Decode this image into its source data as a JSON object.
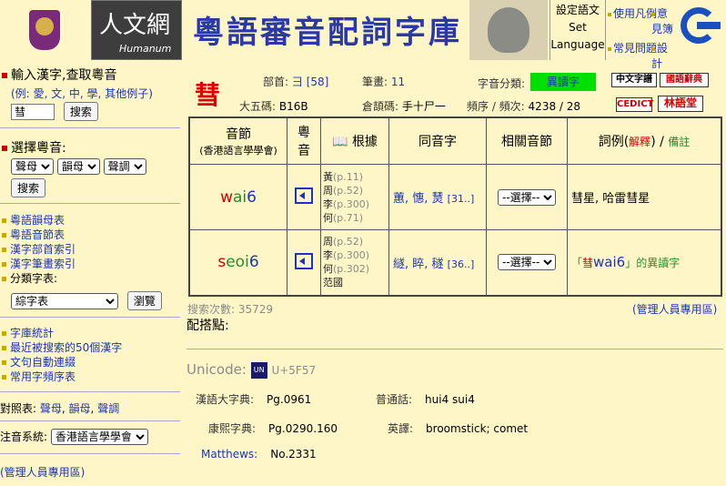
{
  "header": {
    "logo_humanum_big": "人文網",
    "logo_humanum_word": "Humanum",
    "title": "粵語審音配詞字庫",
    "set_language": [
      "設定語文",
      "Set",
      "Language"
    ],
    "nav": {
      "usage": "使用凡例",
      "feedback": "意見簿",
      "faq": "常見問題",
      "stats": "設計"
    }
  },
  "sidebar": {
    "input_title": "輸入漢字,查取粵音",
    "examples_prefix": "(例:",
    "examples": [
      "愛",
      "文",
      "中",
      "學"
    ],
    "examples_more": "其他例子",
    "examples_suffix": ")",
    "search_value": "彗",
    "search_button": "搜索",
    "choose_title": "選擇粵音:",
    "initial_select": "聲母",
    "final_select": "韻母",
    "tone_select": "聲調",
    "search_button2": "搜索",
    "links1": [
      "粵語韻母表",
      "粵語音節表",
      "漢字部首索引",
      "漢字筆畫索引"
    ],
    "category_label": "分類字表:",
    "category_select": "綜字表",
    "browse_button": "瀏覽",
    "links2": [
      "字庫統計",
      "最近被搜索的50個漢字",
      "文句自動連綴",
      "常用字頻序表"
    ],
    "compare_label": "對照表:",
    "compare_links": [
      "聲母",
      "韻母",
      "聲調"
    ],
    "romanization_label": "注音系統:",
    "romanization_value": "香港語言學學會",
    "admin_link": "(管理人員專用區)"
  },
  "character": {
    "glyph": "彗",
    "radical_label": "部首:",
    "radical": "彐",
    "radical_num": "[58]",
    "strokes_label": "筆畫:",
    "strokes": "11",
    "category_label": "字音分類:",
    "category": "異讀字",
    "big5_label": "大五碼:",
    "big5": "B16B",
    "cangjie_label": "倉頡碼:",
    "cangjie": "手十尸一",
    "freq_label": "頻序 / 頻次:",
    "freq": "4238 / 28",
    "dict_buttons": [
      "中文字譜",
      "國語辭典",
      "CEDICT",
      "林語堂"
    ]
  },
  "table": {
    "headers": {
      "syllable": "音節",
      "syllable_sub": "(香港語言學學會)",
      "audio": "粵音",
      "basis": "根據",
      "homophones": "同音字",
      "related": "相關音節",
      "examples": "詞例(",
      "examples_link": "解釋",
      "examples_close": ")",
      "examples_sep": "/",
      "notes": "備註"
    },
    "rows": [
      {
        "initial": "w",
        "final": "ai",
        "tone": "6",
        "sources": [
          {
            "name": "黃",
            "page": "(p.11)"
          },
          {
            "name": "周",
            "page": "(p.52)"
          },
          {
            "name": "李",
            "page": "(p.300)"
          },
          {
            "name": "何",
            "page": "(p.71)"
          }
        ],
        "homophones": "蕙, 憓, 熭",
        "homophones_more": "[31..]",
        "related": "--選擇--",
        "example": "彗星, 哈雷彗星",
        "note": ""
      },
      {
        "initial": "s",
        "final": "eoi",
        "tone": "6",
        "sources": [
          {
            "name": "周",
            "page": "(p.52)"
          },
          {
            "name": "李",
            "page": "(p.300)"
          },
          {
            "name": "何",
            "page": "(p.302)"
          },
          {
            "name": "范國",
            "page": ""
          }
        ],
        "homophones": "繸, 睟, 穟",
        "homophones_more": "[36..]",
        "related": "--選擇--",
        "example": "",
        "note_open": "「",
        "note_char": "彗",
        "note_jp": "wai6",
        "note_close": "」的異讀字"
      }
    ]
  },
  "footer": {
    "search_count": "搜索次數: 35729",
    "admin_link": "(管理人員專用區)",
    "collocation_label": "配搭點:",
    "unicode_label": "Unicode:",
    "unicode_value": "U+5F57",
    "hanyu_label": "漢語大字典:",
    "hanyu_value": "Pg.0961",
    "putonghua_label": "普通話:",
    "putonghua_value": "hui4 sui4",
    "kangxi_label": "康熙字典:",
    "kangxi_value": "Pg.0290.160",
    "english_label": "英譯:",
    "english_value": "broomstick; comet",
    "matthews_label": "Matthews:",
    "matthews_value": "No.2331"
  }
}
